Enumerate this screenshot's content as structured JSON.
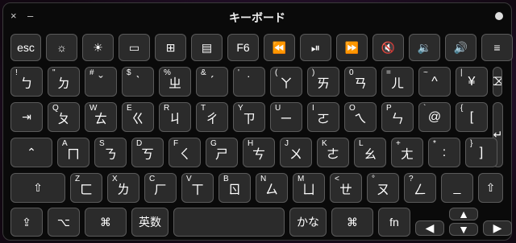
{
  "window": {
    "title": "キーボード",
    "close_icon": "×",
    "minimize_icon": "–"
  },
  "row_fn": [
    {
      "label": "esc"
    },
    {
      "icon": "brightness-down-icon",
      "glyph": "☼"
    },
    {
      "icon": "brightness-up-icon",
      "glyph": "☀"
    },
    {
      "icon": "mission-control-icon",
      "glyph": "▭"
    },
    {
      "icon": "launchpad-icon",
      "glyph": "⊞"
    },
    {
      "icon": "keyboard-backlight-icon",
      "glyph": "▤"
    },
    {
      "label": "F6"
    },
    {
      "icon": "rewind-icon",
      "glyph": "⏪"
    },
    {
      "icon": "play-pause-icon",
      "glyph": "⏯"
    },
    {
      "icon": "fast-forward-icon",
      "glyph": "⏩"
    },
    {
      "icon": "mute-icon",
      "glyph": "🔇"
    },
    {
      "icon": "volume-down-icon",
      "glyph": "🔉"
    },
    {
      "icon": "volume-up-icon",
      "glyph": "🔊"
    },
    {
      "icon": "list-icon",
      "glyph": "≡"
    }
  ],
  "row_num": [
    {
      "top": "!",
      "main": "ㄅ"
    },
    {
      "top": "\"",
      "main": "ㄉ"
    },
    {
      "top": "#",
      "main": "ˇ"
    },
    {
      "top": "$",
      "main": "ˋ"
    },
    {
      "top": "%",
      "main": "ㄓ"
    },
    {
      "top": "&",
      "main": "ˊ"
    },
    {
      "top": "'",
      "main": "˙"
    },
    {
      "top": "(",
      "main": "ㄚ"
    },
    {
      "top": ")",
      "main": "ㄞ"
    },
    {
      "top": "0",
      "main": "ㄢ"
    },
    {
      "top": "=",
      "main": "ㄦ"
    },
    {
      "top": "~",
      "main": "^"
    },
    {
      "top": "|",
      "main": "¥"
    }
  ],
  "backspace_icon": "⌫",
  "row_q": [
    {
      "top": "Q",
      "main": "ㄆ"
    },
    {
      "top": "W",
      "main": "ㄊ"
    },
    {
      "top": "E",
      "main": "ㄍ"
    },
    {
      "top": "R",
      "main": "ㄐ"
    },
    {
      "top": "T",
      "main": "ㄔ"
    },
    {
      "top": "Y",
      "main": "ㄗ"
    },
    {
      "top": "U",
      "main": "ㄧ"
    },
    {
      "top": "I",
      "main": "ㄛ"
    },
    {
      "top": "O",
      "main": "ㄟ"
    },
    {
      "top": "P",
      "main": "ㄣ"
    },
    {
      "top": "`",
      "main": "@"
    },
    {
      "top": "{",
      "main": "["
    }
  ],
  "tab_icon": "⇥",
  "return_icon": "↵",
  "row_a": [
    {
      "top": "A",
      "main": "ㄇ"
    },
    {
      "top": "S",
      "main": "ㄋ"
    },
    {
      "top": "D",
      "main": "ㄎ"
    },
    {
      "top": "F",
      "main": "ㄑ"
    },
    {
      "top": "G",
      "main": "ㄕ"
    },
    {
      "top": "H",
      "main": "ㄘ"
    },
    {
      "top": "J",
      "main": "ㄨ"
    },
    {
      "top": "K",
      "main": "ㄜ"
    },
    {
      "top": "L",
      "main": "ㄠ"
    },
    {
      "top": "+",
      "main": "ㄤ"
    },
    {
      "top": "*",
      "main": ":"
    },
    {
      "top": "}",
      "main": "]"
    }
  ],
  "caps_icon": "⌃",
  "row_z": [
    {
      "top": "Z",
      "main": "ㄈ"
    },
    {
      "top": "X",
      "main": "ㄌ"
    },
    {
      "top": "C",
      "main": "ㄏ"
    },
    {
      "top": "V",
      "main": "ㄒ"
    },
    {
      "top": "B",
      "main": "ㄖ"
    },
    {
      "top": "N",
      "main": "ㄙ"
    },
    {
      "top": "M",
      "main": "ㄩ"
    },
    {
      "top": "<",
      "main": "ㄝ"
    },
    {
      "top": "°",
      "main": "ㄡ"
    },
    {
      "top": "?",
      "main": "ㄥ"
    },
    {
      "top": "",
      "main": "_"
    }
  ],
  "shift_icon": "⇧",
  "bottom": {
    "caps_icon": "⇪",
    "option_icon": "⌥",
    "command_icon": "⌘",
    "eisu": "英数",
    "kana": "かな",
    "fn": "fn",
    "arrow_left": "◀",
    "arrow_up": "▲",
    "arrow_down": "▼",
    "arrow_right": "▶"
  }
}
